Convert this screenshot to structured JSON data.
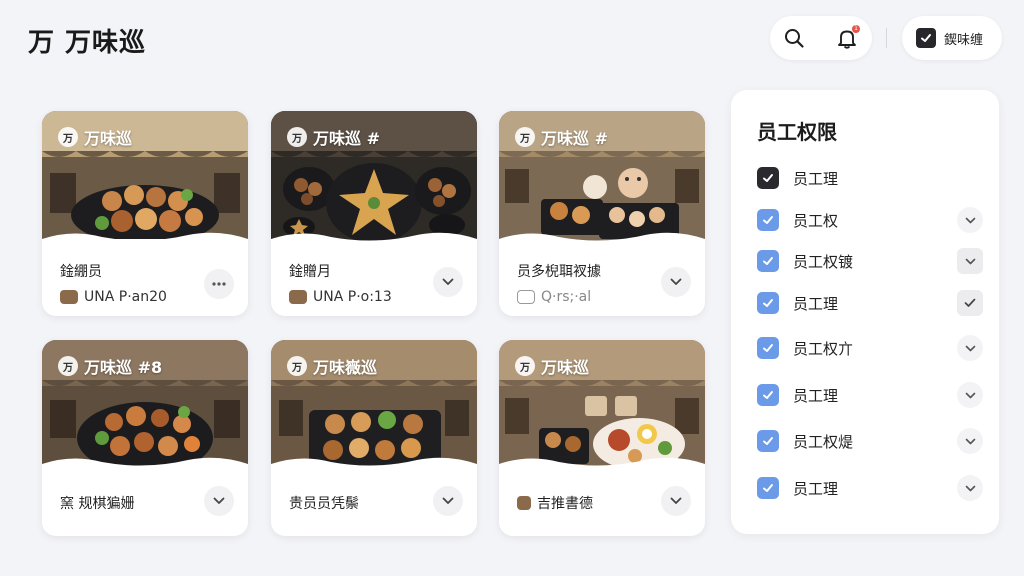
{
  "header": {
    "title": "万 万味巡",
    "notification_count": "1",
    "user_label": "鍥味缠"
  },
  "cards": [
    {
      "brand": "万味巡",
      "title": "鍂綳员",
      "subtitle": "UNA P·an20",
      "action": "more",
      "sub_icon": "food"
    },
    {
      "brand": "万味巡 #",
      "title": "鍂贈月",
      "subtitle": "UNA P·o:13",
      "action": "chevron",
      "sub_icon": "food"
    },
    {
      "brand": "万味巡 #",
      "title": "员多棿聑衩據",
      "subtitle": "Q·rs;·al",
      "action": "chevron",
      "sub_icon": "outline"
    },
    {
      "brand": "万味巡 #8",
      "title": "窯 规棋猵姗",
      "subtitle": "",
      "action": "chevron"
    },
    {
      "brand": "万味嶶巡",
      "title": "贵员员凭鬃",
      "subtitle": "",
      "action": "chevron"
    },
    {
      "brand": "万味巡",
      "title": "吉推書德",
      "subtitle": "",
      "action": "chevron",
      "title_icon": true
    }
  ],
  "permissions": {
    "title": "员工权限",
    "items": [
      {
        "label": "员工理",
        "checked": true,
        "style": "dark",
        "toggle": "none"
      },
      {
        "label": "员工权",
        "checked": true,
        "style": "blue",
        "toggle": "chevron"
      },
      {
        "label": "员工权镀",
        "checked": true,
        "style": "blue",
        "toggle": "chevron-square"
      },
      {
        "label": "员工理",
        "checked": true,
        "style": "blue",
        "toggle": "check-square"
      },
      {
        "label": "员工权亣",
        "checked": true,
        "style": "blue",
        "toggle": "chevron"
      },
      {
        "label": "员工理",
        "checked": true,
        "style": "blue",
        "toggle": "chevron"
      },
      {
        "label": "员工权煶",
        "checked": true,
        "style": "blue",
        "toggle": "chevron"
      },
      {
        "label": "员工理",
        "checked": true,
        "style": "blue",
        "toggle": "chevron"
      }
    ]
  },
  "colors": {
    "background": "#f3f4f8",
    "accent_blue": "#6a9ae8",
    "dark_check": "#2a2a2e",
    "notification_red": "#e5534b"
  },
  "icons": {
    "search": "search-icon",
    "bell": "bell-icon",
    "more": "more-icon",
    "chevron": "chevron-down-icon",
    "check": "check-icon"
  }
}
